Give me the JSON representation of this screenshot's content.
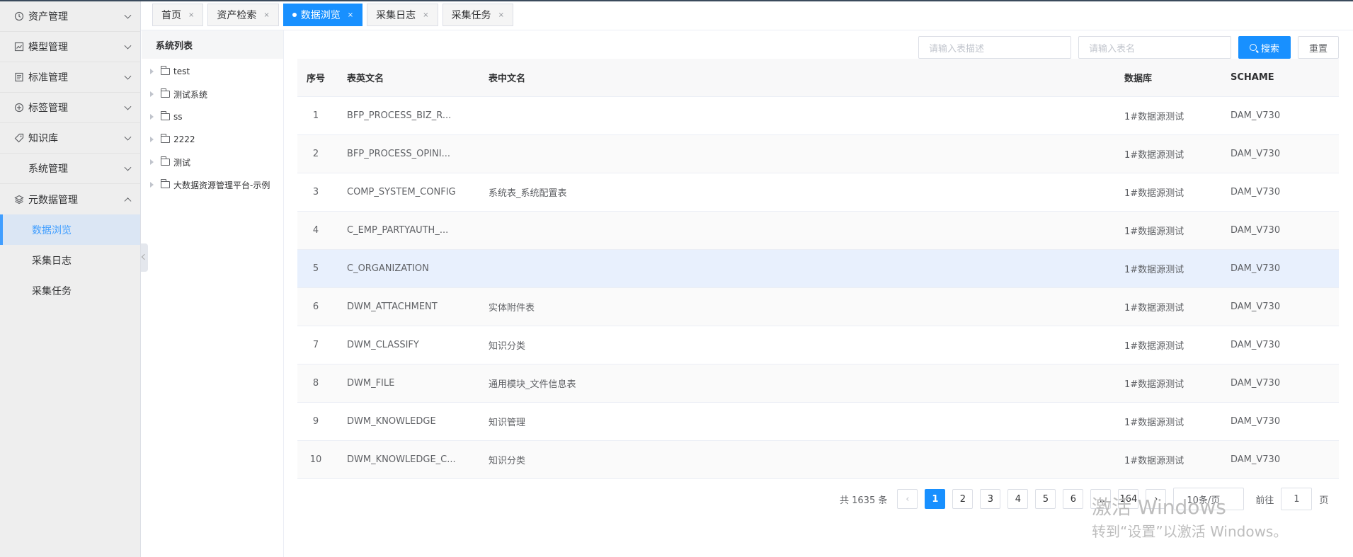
{
  "sidebar": {
    "items": [
      {
        "label": "资产管理",
        "icon": "clock-icon"
      },
      {
        "label": "模型管理",
        "icon": "chart-icon"
      },
      {
        "label": "标准管理",
        "icon": "document-icon"
      },
      {
        "label": "标签管理",
        "icon": "plus-circle-icon"
      },
      {
        "label": "知识库",
        "icon": "tag-icon"
      },
      {
        "label": "系统管理",
        "icon": ""
      },
      {
        "label": "元数据管理",
        "icon": "layers-icon"
      }
    ],
    "subitems": [
      "数据浏览",
      "采集日志",
      "采集任务"
    ]
  },
  "tabs": [
    {
      "label": "首页"
    },
    {
      "label": "资产检索"
    },
    {
      "label": "数据浏览"
    },
    {
      "label": "采集日志"
    },
    {
      "label": "采集任务"
    }
  ],
  "tree": {
    "title": "系统列表",
    "nodes": [
      "test",
      "测试系统",
      "ss",
      "2222",
      "测试",
      "大数据资源管理平台-示例"
    ]
  },
  "search": {
    "desc_placeholder": "请输入表描述",
    "name_placeholder": "请输入表名",
    "search_label": "搜索",
    "reset_label": "重置"
  },
  "table": {
    "headers": [
      "序号",
      "表英文名",
      "表中文名",
      "数据库",
      "SCHAME"
    ],
    "rows": [
      [
        "1",
        "BFP_PROCESS_BIZ_R...",
        "",
        "1#数据源测试",
        "DAM_V730"
      ],
      [
        "2",
        "BFP_PROCESS_OPINI...",
        "",
        "1#数据源测试",
        "DAM_V730"
      ],
      [
        "3",
        "COMP_SYSTEM_CONFIG",
        "系统表_系统配置表",
        "1#数据源测试",
        "DAM_V730"
      ],
      [
        "4",
        "C_EMP_PARTYAUTH_...",
        "",
        "1#数据源测试",
        "DAM_V730"
      ],
      [
        "5",
        "C_ORGANIZATION",
        "",
        "1#数据源测试",
        "DAM_V730"
      ],
      [
        "6",
        "DWM_ATTACHMENT",
        "实体附件表",
        "1#数据源测试",
        "DAM_V730"
      ],
      [
        "7",
        "DWM_CLASSIFY",
        "知识分类",
        "1#数据源测试",
        "DAM_V730"
      ],
      [
        "8",
        "DWM_FILE",
        "通用模块_文件信息表",
        "1#数据源测试",
        "DAM_V730"
      ],
      [
        "9",
        "DWM_KNOWLEDGE",
        "知识管理",
        "1#数据源测试",
        "DAM_V730"
      ],
      [
        "10",
        "DWM_KNOWLEDGE_C...",
        "知识分类",
        "1#数据源测试",
        "DAM_V730"
      ]
    ]
  },
  "pagination": {
    "total": "共 1635 条",
    "pages": [
      "1",
      "2",
      "3",
      "4",
      "5",
      "6"
    ],
    "ellipsis": "...",
    "last": "164",
    "prev": "‹",
    "next": "›",
    "page_size": "10条/页",
    "goto_label": "前往",
    "goto_value": "1",
    "page_suffix": "页"
  },
  "watermark": {
    "line1": "激活 Windows",
    "line2": "转到“设置”以激活 Windows。"
  }
}
